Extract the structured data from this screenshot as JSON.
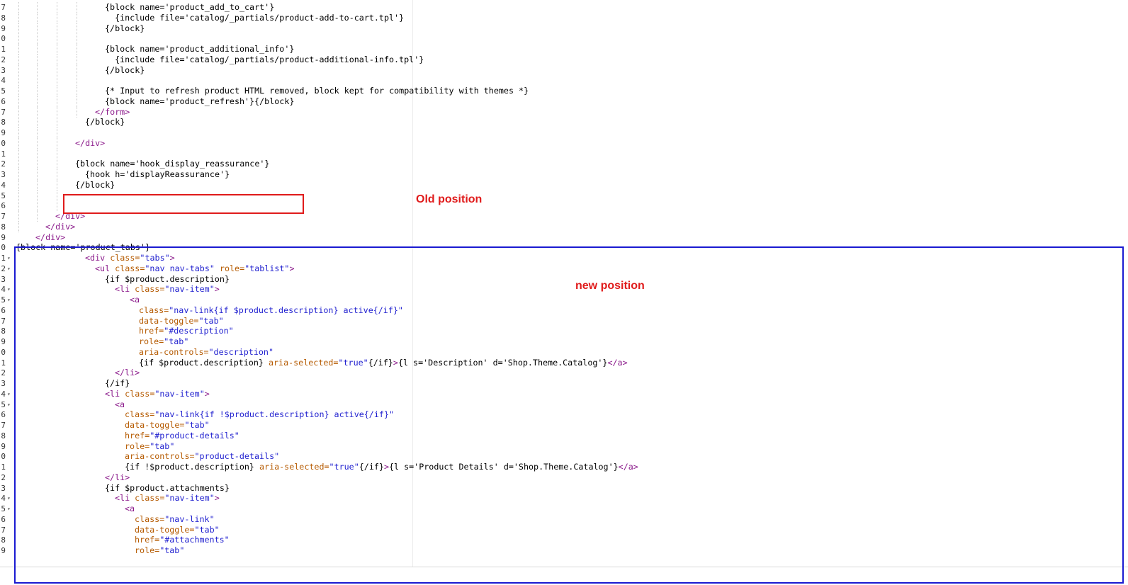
{
  "lines": [
    {
      "num": "7",
      "fold": false,
      "segs": [
        [
          "s",
          "{block name='product_add_to_cart'}"
        ]
      ],
      "indent": 148,
      "guides": [
        26,
        52,
        80,
        108
      ]
    },
    {
      "num": "8",
      "fold": false,
      "segs": [
        [
          "s",
          "{include file='catalog/_partials/product-add-to-cart.tpl'}"
        ]
      ],
      "indent": 162,
      "guides": [
        26,
        52,
        80,
        108
      ]
    },
    {
      "num": "9",
      "fold": false,
      "segs": [
        [
          "s",
          "{/block}"
        ]
      ],
      "indent": 148,
      "guides": [
        26,
        52,
        80,
        108
      ]
    },
    {
      "num": "0",
      "fold": false,
      "segs": [],
      "indent": 0,
      "guides": [
        26,
        52,
        80,
        108
      ]
    },
    {
      "num": "1",
      "fold": false,
      "segs": [
        [
          "s",
          "{block name='product_additional_info'}"
        ]
      ],
      "indent": 148,
      "guides": [
        26,
        52,
        80,
        108
      ]
    },
    {
      "num": "2",
      "fold": false,
      "segs": [
        [
          "s",
          "{include file='catalog/_partials/product-additional-info.tpl'}"
        ]
      ],
      "indent": 162,
      "guides": [
        26,
        52,
        80,
        108
      ]
    },
    {
      "num": "3",
      "fold": false,
      "segs": [
        [
          "s",
          "{/block}"
        ]
      ],
      "indent": 148,
      "guides": [
        26,
        52,
        80,
        108
      ]
    },
    {
      "num": "4",
      "fold": false,
      "segs": [],
      "indent": 0,
      "guides": [
        26,
        52,
        80,
        108
      ]
    },
    {
      "num": "5",
      "fold": false,
      "segs": [
        [
          "s",
          "{* Input to refresh product HTML removed, block kept for compatibility with themes *}"
        ]
      ],
      "indent": 148,
      "guides": [
        26,
        52,
        80,
        108
      ]
    },
    {
      "num": "6",
      "fold": false,
      "segs": [
        [
          "s",
          "{block name='product_refresh'}{/block}"
        ]
      ],
      "indent": 148,
      "guides": [
        26,
        52,
        80,
        108
      ]
    },
    {
      "num": "7",
      "fold": false,
      "segs": [
        [
          "t",
          "</form>"
        ]
      ],
      "indent": 134,
      "guides": [
        26,
        52,
        80,
        108
      ]
    },
    {
      "num": "8",
      "fold": false,
      "segs": [
        [
          "s",
          "{/block}"
        ]
      ],
      "indent": 120,
      "guides": [
        26,
        52,
        80
      ]
    },
    {
      "num": "9",
      "fold": false,
      "segs": [],
      "indent": 0,
      "guides": [
        26,
        52,
        80
      ]
    },
    {
      "num": "0",
      "fold": false,
      "segs": [
        [
          "t",
          "</div>"
        ]
      ],
      "indent": 106,
      "guides": [
        26,
        52,
        80
      ]
    },
    {
      "num": "1",
      "fold": false,
      "segs": [],
      "indent": 0,
      "guides": [
        26,
        52,
        80
      ]
    },
    {
      "num": "2",
      "fold": false,
      "segs": [
        [
          "s",
          "{block name='hook_display_reassurance'}"
        ]
      ],
      "indent": 106,
      "guides": [
        26,
        52,
        80
      ]
    },
    {
      "num": "3",
      "fold": false,
      "segs": [
        [
          "s",
          "{hook h='displayReassurance'}"
        ]
      ],
      "indent": 120,
      "guides": [
        26,
        52,
        80
      ]
    },
    {
      "num": "4",
      "fold": false,
      "segs": [
        [
          "s",
          "{/block}"
        ]
      ],
      "indent": 106,
      "guides": [
        26,
        52,
        80
      ]
    },
    {
      "num": "5",
      "fold": false,
      "segs": [],
      "indent": 0,
      "guides": [
        26,
        52,
        80
      ]
    },
    {
      "num": "6",
      "fold": false,
      "segs": [],
      "indent": 0,
      "guides": [
        26,
        52,
        80
      ]
    },
    {
      "num": "7",
      "fold": false,
      "segs": [
        [
          "t",
          "</div>"
        ]
      ],
      "indent": 78,
      "guides": [
        26,
        52
      ]
    },
    {
      "num": "8",
      "fold": false,
      "segs": [
        [
          "t",
          "</div>"
        ]
      ],
      "indent": 64,
      "guides": [
        26
      ]
    },
    {
      "num": "9",
      "fold": false,
      "segs": [
        [
          "t",
          "</div>"
        ]
      ],
      "indent": 50,
      "guides": []
    },
    {
      "num": "0",
      "fold": false,
      "segs": [
        [
          "s",
          "{block name='product_tabs'}"
        ]
      ],
      "indent": 22,
      "guides": []
    },
    {
      "num": "1",
      "fold": true,
      "segs": [
        [
          "t",
          "<div "
        ],
        [
          "a",
          "class="
        ],
        [
          "q",
          "\"tabs\""
        ],
        [
          "t",
          ">"
        ]
      ],
      "indent": 120,
      "guides": []
    },
    {
      "num": "2",
      "fold": true,
      "segs": [
        [
          "t",
          "<ul "
        ],
        [
          "a",
          "class="
        ],
        [
          "q",
          "\"nav nav-tabs\""
        ],
        [
          "a",
          " role="
        ],
        [
          "q",
          "\"tablist\""
        ],
        [
          "t",
          ">"
        ]
      ],
      "indent": 134,
      "guides": []
    },
    {
      "num": "3",
      "fold": false,
      "segs": [
        [
          "s",
          "{if $product.description}"
        ]
      ],
      "indent": 148,
      "guides": []
    },
    {
      "num": "4",
      "fold": true,
      "segs": [
        [
          "t",
          "<li "
        ],
        [
          "a",
          "class="
        ],
        [
          "q",
          "\"nav-item\""
        ],
        [
          "t",
          ">"
        ]
      ],
      "indent": 162,
      "guides": []
    },
    {
      "num": "5",
      "fold": true,
      "segs": [
        [
          "t",
          "<a"
        ]
      ],
      "indent": 183,
      "guides": []
    },
    {
      "num": "6",
      "fold": false,
      "segs": [
        [
          "a",
          "class="
        ],
        [
          "q",
          "\"nav-link{if $product.description} active{/if}\""
        ]
      ],
      "indent": 196,
      "guides": []
    },
    {
      "num": "7",
      "fold": false,
      "segs": [
        [
          "a",
          "data-toggle="
        ],
        [
          "q",
          "\"tab\""
        ]
      ],
      "indent": 196,
      "guides": []
    },
    {
      "num": "8",
      "fold": false,
      "segs": [
        [
          "a",
          "href="
        ],
        [
          "q",
          "\"#description\""
        ]
      ],
      "indent": 196,
      "guides": []
    },
    {
      "num": "9",
      "fold": false,
      "segs": [
        [
          "a",
          "role="
        ],
        [
          "q",
          "\"tab\""
        ]
      ],
      "indent": 196,
      "guides": []
    },
    {
      "num": "0",
      "fold": false,
      "segs": [
        [
          "a",
          "aria-controls="
        ],
        [
          "q",
          "\"description\""
        ]
      ],
      "indent": 196,
      "guides": []
    },
    {
      "num": "1",
      "fold": false,
      "segs": [
        [
          "s",
          "{if $product.description} "
        ],
        [
          "a",
          "aria-selected="
        ],
        [
          "q",
          "\"true\""
        ],
        [
          "s",
          "{/if}"
        ],
        [
          "t",
          ">"
        ],
        [
          "s",
          "{l s='Description' d='Shop.Theme.Catalog'}"
        ],
        [
          "t",
          "</a>"
        ]
      ],
      "indent": 196,
      "guides": []
    },
    {
      "num": "2",
      "fold": false,
      "segs": [
        [
          "t",
          "</li>"
        ]
      ],
      "indent": 162,
      "guides": []
    },
    {
      "num": "3",
      "fold": false,
      "segs": [
        [
          "s",
          "{/if}"
        ]
      ],
      "indent": 148,
      "guides": []
    },
    {
      "num": "4",
      "fold": true,
      "segs": [
        [
          "t",
          "<li "
        ],
        [
          "a",
          "class="
        ],
        [
          "q",
          "\"nav-item\""
        ],
        [
          "t",
          ">"
        ]
      ],
      "indent": 148,
      "guides": []
    },
    {
      "num": "5",
      "fold": true,
      "segs": [
        [
          "t",
          "<a"
        ]
      ],
      "indent": 162,
      "guides": []
    },
    {
      "num": "6",
      "fold": false,
      "segs": [
        [
          "a",
          "class="
        ],
        [
          "q",
          "\"nav-link{if !$product.description} active{/if}\""
        ]
      ],
      "indent": 176,
      "guides": []
    },
    {
      "num": "7",
      "fold": false,
      "segs": [
        [
          "a",
          "data-toggle="
        ],
        [
          "q",
          "\"tab\""
        ]
      ],
      "indent": 176,
      "guides": []
    },
    {
      "num": "8",
      "fold": false,
      "segs": [
        [
          "a",
          "href="
        ],
        [
          "q",
          "\"#product-details\""
        ]
      ],
      "indent": 176,
      "guides": []
    },
    {
      "num": "9",
      "fold": false,
      "segs": [
        [
          "a",
          "role="
        ],
        [
          "q",
          "\"tab\""
        ]
      ],
      "indent": 176,
      "guides": []
    },
    {
      "num": "0",
      "fold": false,
      "segs": [
        [
          "a",
          "aria-controls="
        ],
        [
          "q",
          "\"product-details\""
        ]
      ],
      "indent": 176,
      "guides": []
    },
    {
      "num": "1",
      "fold": false,
      "segs": [
        [
          "s",
          "{if !$product.description} "
        ],
        [
          "a",
          "aria-selected="
        ],
        [
          "q",
          "\"true\""
        ],
        [
          "s",
          "{/if}"
        ],
        [
          "t",
          ">"
        ],
        [
          "s",
          "{l s='Product Details' d='Shop.Theme.Catalog'}"
        ],
        [
          "t",
          "</a>"
        ]
      ],
      "indent": 176,
      "guides": []
    },
    {
      "num": "2",
      "fold": false,
      "segs": [
        [
          "t",
          "</li>"
        ]
      ],
      "indent": 148,
      "guides": []
    },
    {
      "num": "3",
      "fold": false,
      "segs": [
        [
          "s",
          "{if $product.attachments}"
        ]
      ],
      "indent": 148,
      "guides": []
    },
    {
      "num": "4",
      "fold": true,
      "segs": [
        [
          "t",
          "<li "
        ],
        [
          "a",
          "class="
        ],
        [
          "q",
          "\"nav-item\""
        ],
        [
          "t",
          ">"
        ]
      ],
      "indent": 162,
      "guides": []
    },
    {
      "num": "5",
      "fold": true,
      "segs": [
        [
          "t",
          "<a"
        ]
      ],
      "indent": 176,
      "guides": []
    },
    {
      "num": "6",
      "fold": false,
      "segs": [
        [
          "a",
          "class="
        ],
        [
          "q",
          "\"nav-link\""
        ]
      ],
      "indent": 190,
      "guides": []
    },
    {
      "num": "7",
      "fold": false,
      "segs": [
        [
          "a",
          "data-toggle="
        ],
        [
          "q",
          "\"tab\""
        ]
      ],
      "indent": 190,
      "guides": []
    },
    {
      "num": "8",
      "fold": false,
      "segs": [
        [
          "a",
          "href="
        ],
        [
          "q",
          "\"#attachments\""
        ]
      ],
      "indent": 190,
      "guides": []
    },
    {
      "num": "9",
      "fold": false,
      "segs": [
        [
          "a",
          "role="
        ],
        [
          "q",
          "\"tab\""
        ]
      ],
      "indent": 190,
      "guides": []
    }
  ],
  "annotations": {
    "old_label": "Old position",
    "new_label": "new position",
    "old_color": "#e01b1b",
    "new_color": "#1a1ad1"
  }
}
